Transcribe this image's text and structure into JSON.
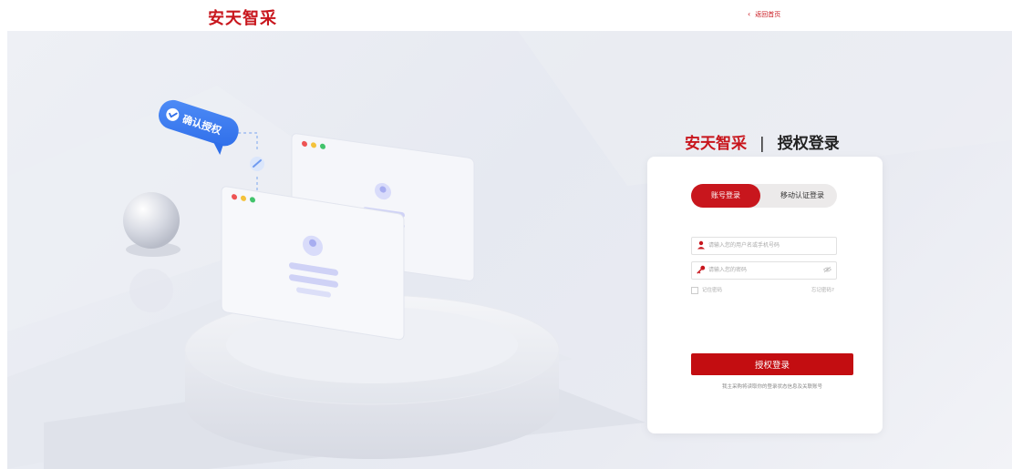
{
  "header": {
    "brand": "安天智采",
    "back_link": "返回首页"
  },
  "illustration": {
    "badge_text": "确认授权"
  },
  "login": {
    "title_brand": "安天智采",
    "title_separator": "|",
    "title_text": "授权登录",
    "tabs": [
      {
        "label": "账号登录",
        "active": true
      },
      {
        "label": "移动认证登录",
        "active": false
      }
    ],
    "username_placeholder": "请输入您的用户名或手机号码",
    "password_placeholder": "请输入您的密码",
    "remember_label": "记住密码",
    "forgot_label": "忘记密码?",
    "submit_label": "授权登录",
    "note": "我主采购将读取你的登录状态信息及关联账号"
  },
  "colors": {
    "brand_red": "#c8161d",
    "button_red": "#c30d11",
    "hero_bg": "#e8eaf1"
  }
}
